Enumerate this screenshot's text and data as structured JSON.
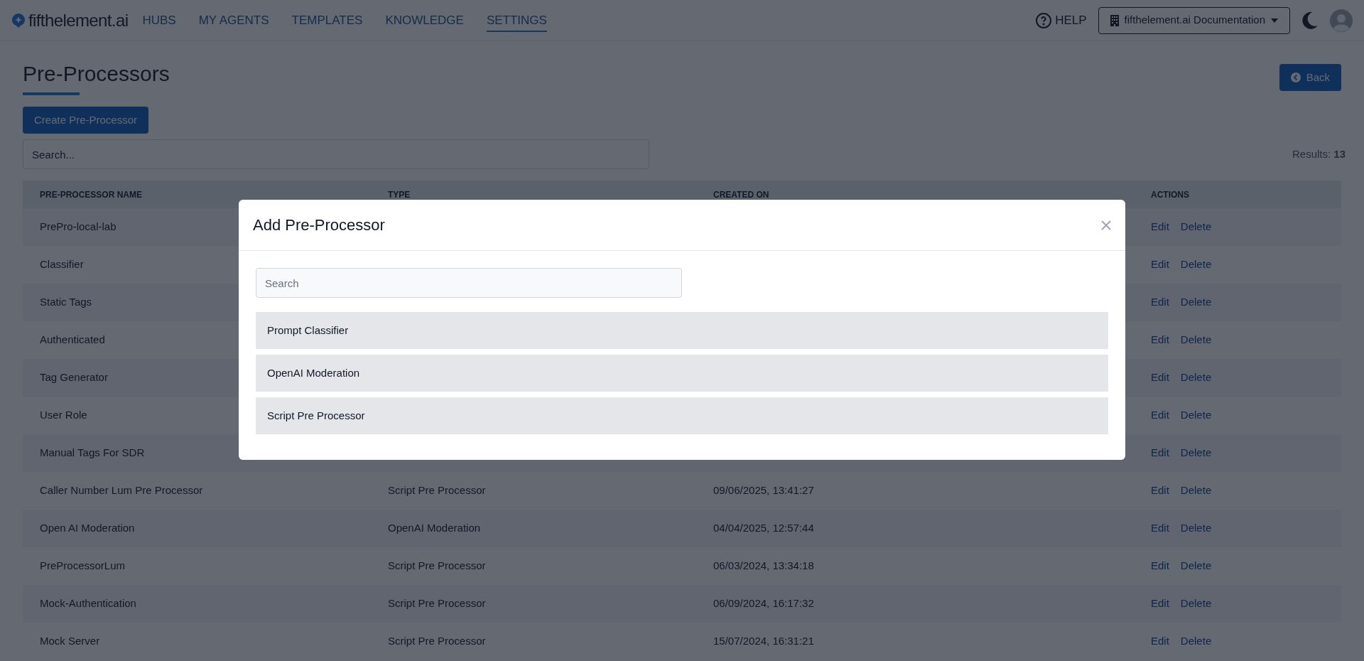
{
  "brand": {
    "name": "fifthelement.ai"
  },
  "nav": [
    {
      "label": "HUBS",
      "selected": false
    },
    {
      "label": "MY AGENTS",
      "selected": false
    },
    {
      "label": "TEMPLATES",
      "selected": false
    },
    {
      "label": "KNOWLEDGE",
      "selected": false
    },
    {
      "label": "SETTINGS",
      "selected": true
    }
  ],
  "header_right": {
    "help": "HELP",
    "workspace": "fifthelement.ai Documentation"
  },
  "page": {
    "title": "Pre-Processors",
    "back_button": "Back",
    "create_button": "Create Pre-Processor",
    "search_placeholder": "Search...",
    "results_label": "Results:",
    "results_count": "13"
  },
  "table": {
    "columns": [
      "PRE-PROCESSOR NAME",
      "TYPE",
      "CREATED ON",
      "ACTIONS"
    ],
    "rows": [
      {
        "name": "PrePro-local-lab",
        "actions": [
          "Edit",
          "Delete"
        ]
      },
      {
        "name": "Classifier",
        "actions": [
          "Edit",
          "Delete"
        ]
      },
      {
        "name": "Static Tags",
        "actions": [
          "Edit",
          "Delete"
        ]
      },
      {
        "name": "Authenticated",
        "actions": [
          "Edit",
          "Delete"
        ]
      },
      {
        "name": "Tag Generator",
        "actions": [
          "Edit",
          "Delete"
        ]
      },
      {
        "name": "User Role",
        "actions": [
          "Edit",
          "Delete"
        ]
      },
      {
        "name": "Manual Tags For SDR",
        "actions": [
          "Edit",
          "Delete"
        ]
      },
      {
        "name": "Caller Number Lum Pre Processor",
        "type": "Script Pre Processor",
        "created_on": "09/06/2025, 13:41:27",
        "actions": [
          "Edit",
          "Delete"
        ]
      },
      {
        "name": "Open AI Moderation",
        "type": "OpenAI Moderation",
        "created_on": "04/04/2025, 12:57:44",
        "actions": [
          "Edit",
          "Delete"
        ]
      },
      {
        "name": "PreProcessorLum",
        "type": "Script Pre Processor",
        "created_on": "06/03/2024, 13:34:18",
        "actions": [
          "Edit",
          "Delete"
        ]
      },
      {
        "name": "Mock-Authentication",
        "type": "Script Pre Processor",
        "created_on": "06/09/2024, 16:17:32",
        "actions": [
          "Edit",
          "Delete"
        ]
      },
      {
        "name": "Mock Server",
        "type": "Script Pre Processor",
        "created_on": "15/07/2024, 16:31:21",
        "actions": [
          "Edit",
          "Delete"
        ]
      }
    ]
  },
  "modal": {
    "title": "Add Pre-Processor",
    "search_placeholder": "Search",
    "options": [
      "Prompt Classifier",
      "OpenAI Moderation",
      "Script Pre Processor"
    ]
  }
}
